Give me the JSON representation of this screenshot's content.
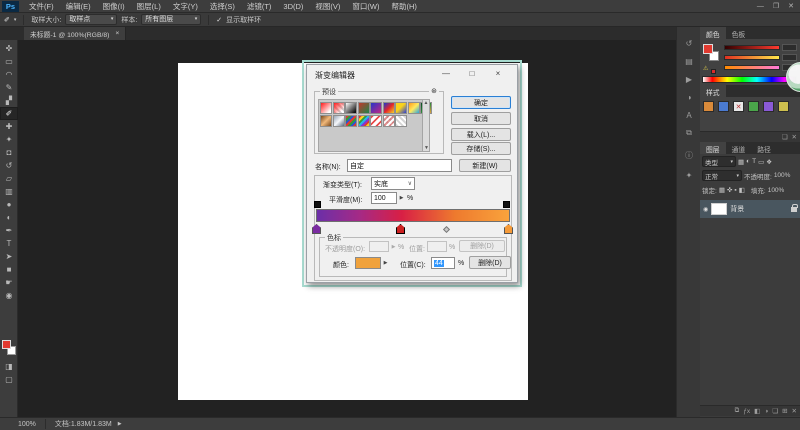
{
  "app": {
    "window_controls": {
      "minimize": "—",
      "maximize": "❐",
      "close": "✕"
    }
  },
  "menu_bar": {
    "logo": "Ps",
    "items": [
      "文件(F)",
      "编辑(E)",
      "图像(I)",
      "图层(L)",
      "文字(Y)",
      "选择(S)",
      "滤镜(T)",
      "3D(D)",
      "视图(V)",
      "窗口(W)",
      "帮助(H)"
    ]
  },
  "options_bar": {
    "tool_glyph": "✐",
    "dropdown_arrow": "▾",
    "sample_size_label": "取样大小:",
    "sample_size_value": "取样点",
    "sample_label": "样本:",
    "sample_value": "所有图层",
    "check_glyph": "✓",
    "show_ring_label": "显示取样环"
  },
  "document_tab": {
    "title": "未标题-1 @ 100%(RGB/8)",
    "close_glyph": "×"
  },
  "toolbar": {
    "tools": [
      {
        "name": "move",
        "glyph": "✜"
      },
      {
        "name": "marquee",
        "glyph": "▭"
      },
      {
        "name": "lasso",
        "glyph": "◠"
      },
      {
        "name": "quick-selection",
        "glyph": "✎"
      },
      {
        "name": "crop",
        "glyph": "▞"
      },
      {
        "name": "eyedropper",
        "glyph": "✐"
      },
      {
        "name": "healing-brush",
        "glyph": "✚"
      },
      {
        "name": "brush",
        "glyph": "✦"
      },
      {
        "name": "clone-stamp",
        "glyph": "◘"
      },
      {
        "name": "history-brush",
        "glyph": "↺"
      },
      {
        "name": "eraser",
        "glyph": "▱"
      },
      {
        "name": "gradient",
        "glyph": "▥"
      },
      {
        "name": "blur",
        "glyph": "●"
      },
      {
        "name": "dodge",
        "glyph": "◐"
      },
      {
        "name": "pen",
        "glyph": "✒"
      },
      {
        "name": "type",
        "glyph": "T"
      },
      {
        "name": "path-selection",
        "glyph": "➤"
      },
      {
        "name": "shape",
        "glyph": "■"
      },
      {
        "name": "hand",
        "glyph": "☛"
      },
      {
        "name": "zoom",
        "glyph": "◉"
      }
    ],
    "foreground_color": "#e13a30",
    "background_color": "#ffffff",
    "quick_mask_glyph": "◨",
    "screen_mode_glyph": "▢"
  },
  "dialog": {
    "title": "渐变编辑器",
    "controls": {
      "minimize": "—",
      "maximize": "□",
      "close": "×"
    },
    "presets": {
      "label": "预设",
      "gear_glyph": "⊛",
      "scroll_up": "▲",
      "scroll_down": "▼",
      "tiles": [
        "linear-gradient(135deg,#ff1a1a 0%,#ffffff 85%)",
        "linear-gradient(135deg,#ff1a1a 0%,rgba(255,26,26,0) 80%),repeating-linear-gradient(45deg,#cfcfcf 0 2px,#ffffff 2px 4px)",
        "linear-gradient(135deg,#fdfdfd 0%,#111111 90%)",
        "linear-gradient(135deg,#c0392b,#1e8449)",
        "linear-gradient(135deg,#2637c8,#c32684)",
        "linear-gradient(135deg,#1a3bd0 0%,#e3262a 50%,#f5d327 100%)",
        "linear-gradient(135deg,#f8d21c 0%,#f8d21c 45%,#2b3fd6 100%)",
        "linear-gradient(135deg,#ff9d1c,#ffe95e,#2aa6e0)",
        "linear-gradient(135deg,#0c4a22,#2e8b3a,#e8a23c)",
        "linear-gradient(135deg,#7a4a1e,#f0b87a,#7a4a1e)",
        "linear-gradient(135deg,#9aa7b8,#f5f7fa,#5a6a7e)",
        "repeating-linear-gradient(135deg,#e23a2e 0 2px,#2e9e3a 2px 4px,#2a52d6 4px 6px)",
        "repeating-linear-gradient(135deg,#e23a2e 0 2px,#f5d327 2px 4px,#2e9e3a 4px 6px,#27b5e8 6px 8px,#8136d6 8px 10px)",
        "repeating-linear-gradient(135deg,#e84a4a 0 2px,#ffffff 2px 5px)",
        "repeating-linear-gradient(135deg,rgba(255,255,255,.9) 0 2px,rgba(200,60,60,.55) 2px 4px),repeating-linear-gradient(45deg,#d8d8d8 0 2px,#ffffff 2px 4px)",
        "repeating-linear-gradient(45deg,#d4d4d4 0 2px,#ffffff 2px 4px)"
      ]
    },
    "buttons": {
      "ok": "确定",
      "cancel": "取消",
      "load": "载入(L)...",
      "save": "存储(S)..."
    },
    "name_row": {
      "label": "名称(N):",
      "value": "自定",
      "new_button": "新建(W)"
    },
    "type_row": {
      "label": "渐变类型(T):",
      "value": "实底",
      "arrow": "∨"
    },
    "smooth_row": {
      "label": "平滑度(M):",
      "value": "100",
      "spinner": "▶",
      "percent": "%"
    },
    "gradient": {
      "bar_css": "linear-gradient(90deg,#6b2fa8 0%,#a52a86 22%,#d81f45 44%,#ee7a2e 72%,#f9a33c 100%)",
      "left_stop_color": "#7b2ca2",
      "middle_stop_color": "#cc2121",
      "right_stop_color": "#f59a38"
    },
    "stops": {
      "label": "色标",
      "opacity_label": "不透明度(O):",
      "opacity_spinner": "▶",
      "opacity_percent": "%",
      "location_label": "位置:",
      "location_percent": "%",
      "delete_disabled_label": "删除(D)",
      "color_label": "颜色:",
      "color_value": "#f0a23c",
      "color_arrow": "▶",
      "location2_label": "位置(C):",
      "location2_value": "44",
      "location2_percent": "%",
      "delete_label": "删除(D)"
    }
  },
  "dock_strip": {
    "icons": [
      {
        "name": "history",
        "glyph": "↺"
      },
      {
        "name": "properties",
        "glyph": "▤"
      },
      {
        "name": "actions",
        "glyph": "▶"
      },
      {
        "name": "adjustments",
        "glyph": "◑"
      },
      {
        "name": "character",
        "glyph": "A"
      },
      {
        "name": "clone-source",
        "glyph": "⧉"
      },
      {
        "name": "info",
        "glyph": "ⓘ"
      },
      {
        "name": "navigator",
        "glyph": "✦"
      }
    ]
  },
  "panels": {
    "color": {
      "tabs": [
        "颜色",
        "色板"
      ],
      "slider_css": [
        "linear-gradient(90deg,#330000,#ff3b30)",
        "linear-gradient(90deg,#e03020,#ffe84a)",
        "linear-gradient(90deg,#ff8a00,#ff7ad9)"
      ],
      "gamut_glyph": "⚠",
      "gamut_color": "#d92b2b",
      "spectrum_css": "linear-gradient(90deg,#ffffff 0,#ff0000 10%,#ffff00 26%,#00ff00 42%,#00ffff 58%,#0000ff 74%,#ff00ff 88%,#000000 100%)"
    },
    "styles": {
      "tab": "样式",
      "chips": [
        {
          "bg": "#d98a3a",
          "glyph": ""
        },
        {
          "bg": "#4a7ad0",
          "glyph": ""
        },
        {
          "bg": "#e8e8e8",
          "glyph": "✕"
        },
        {
          "bg": "#4aa54a",
          "glyph": ""
        },
        {
          "bg": "#8a5ad6",
          "glyph": ""
        },
        {
          "bg": "#cdbf4e",
          "glyph": ""
        }
      ],
      "bottom_icons": [
        {
          "name": "new-style",
          "glyph": "❏"
        },
        {
          "name": "delete-style",
          "glyph": "✕"
        }
      ]
    },
    "layers": {
      "tabs": [
        "图层",
        "通道",
        "路径"
      ],
      "filter_label": "类型",
      "filter_arrow": "▾",
      "filter_icons": [
        {
          "name": "filter-pixel",
          "glyph": "▦"
        },
        {
          "name": "filter-adjustment",
          "glyph": "◐"
        },
        {
          "name": "filter-type",
          "glyph": "T"
        },
        {
          "name": "filter-shape",
          "glyph": "▭"
        },
        {
          "name": "filter-smart",
          "glyph": "❖"
        }
      ],
      "blend_mode": "正常",
      "blend_arrow": "▾",
      "opacity_label": "不透明度:",
      "opacity_value": "100%",
      "lock_label": "锁定:",
      "lock_icons": [
        {
          "name": "lock-transparent",
          "glyph": "▦"
        },
        {
          "name": "lock-pixels",
          "glyph": "✜"
        },
        {
          "name": "lock-position",
          "glyph": "▪"
        },
        {
          "name": "lock-all",
          "glyph": "◧"
        }
      ],
      "fill_label": "填充:",
      "fill_value": "100%",
      "layer": {
        "eye_glyph": "◉",
        "name": "背景"
      },
      "bottom_icons": [
        {
          "name": "link-layers",
          "glyph": "⧉"
        },
        {
          "name": "layer-effects",
          "glyph": "ƒx"
        },
        {
          "name": "layer-mask",
          "glyph": "◧"
        },
        {
          "name": "adjustment-layer",
          "glyph": "◑"
        },
        {
          "name": "layer-group",
          "glyph": "❏"
        },
        {
          "name": "new-layer",
          "glyph": "⊞"
        },
        {
          "name": "delete-layer",
          "glyph": "✕"
        }
      ]
    }
  },
  "status_bar": {
    "zoom": "100%",
    "doc_info": "文档:1.83M/1.83M",
    "arrow": "▶"
  }
}
